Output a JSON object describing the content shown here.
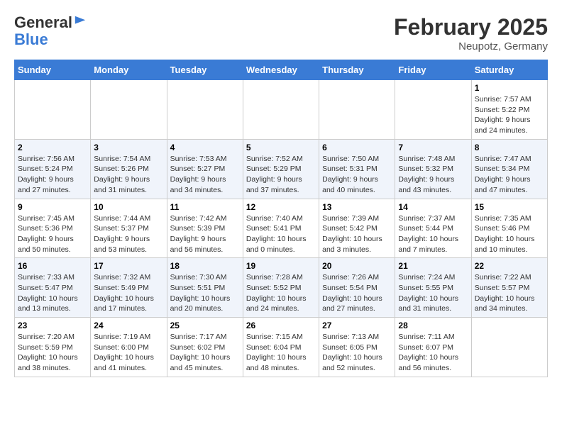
{
  "header": {
    "logo_general": "General",
    "logo_blue": "Blue",
    "month_title": "February 2025",
    "location": "Neupotz, Germany"
  },
  "days_of_week": [
    "Sunday",
    "Monday",
    "Tuesday",
    "Wednesday",
    "Thursday",
    "Friday",
    "Saturday"
  ],
  "weeks": [
    [
      {
        "day": "",
        "info": ""
      },
      {
        "day": "",
        "info": ""
      },
      {
        "day": "",
        "info": ""
      },
      {
        "day": "",
        "info": ""
      },
      {
        "day": "",
        "info": ""
      },
      {
        "day": "",
        "info": ""
      },
      {
        "day": "1",
        "info": "Sunrise: 7:57 AM\nSunset: 5:22 PM\nDaylight: 9 hours and 24 minutes."
      }
    ],
    [
      {
        "day": "2",
        "info": "Sunrise: 7:56 AM\nSunset: 5:24 PM\nDaylight: 9 hours and 27 minutes."
      },
      {
        "day": "3",
        "info": "Sunrise: 7:54 AM\nSunset: 5:26 PM\nDaylight: 9 hours and 31 minutes."
      },
      {
        "day": "4",
        "info": "Sunrise: 7:53 AM\nSunset: 5:27 PM\nDaylight: 9 hours and 34 minutes."
      },
      {
        "day": "5",
        "info": "Sunrise: 7:52 AM\nSunset: 5:29 PM\nDaylight: 9 hours and 37 minutes."
      },
      {
        "day": "6",
        "info": "Sunrise: 7:50 AM\nSunset: 5:31 PM\nDaylight: 9 hours and 40 minutes."
      },
      {
        "day": "7",
        "info": "Sunrise: 7:48 AM\nSunset: 5:32 PM\nDaylight: 9 hours and 43 minutes."
      },
      {
        "day": "8",
        "info": "Sunrise: 7:47 AM\nSunset: 5:34 PM\nDaylight: 9 hours and 47 minutes."
      }
    ],
    [
      {
        "day": "9",
        "info": "Sunrise: 7:45 AM\nSunset: 5:36 PM\nDaylight: 9 hours and 50 minutes."
      },
      {
        "day": "10",
        "info": "Sunrise: 7:44 AM\nSunset: 5:37 PM\nDaylight: 9 hours and 53 minutes."
      },
      {
        "day": "11",
        "info": "Sunrise: 7:42 AM\nSunset: 5:39 PM\nDaylight: 9 hours and 56 minutes."
      },
      {
        "day": "12",
        "info": "Sunrise: 7:40 AM\nSunset: 5:41 PM\nDaylight: 10 hours and 0 minutes."
      },
      {
        "day": "13",
        "info": "Sunrise: 7:39 AM\nSunset: 5:42 PM\nDaylight: 10 hours and 3 minutes."
      },
      {
        "day": "14",
        "info": "Sunrise: 7:37 AM\nSunset: 5:44 PM\nDaylight: 10 hours and 7 minutes."
      },
      {
        "day": "15",
        "info": "Sunrise: 7:35 AM\nSunset: 5:46 PM\nDaylight: 10 hours and 10 minutes."
      }
    ],
    [
      {
        "day": "16",
        "info": "Sunrise: 7:33 AM\nSunset: 5:47 PM\nDaylight: 10 hours and 13 minutes."
      },
      {
        "day": "17",
        "info": "Sunrise: 7:32 AM\nSunset: 5:49 PM\nDaylight: 10 hours and 17 minutes."
      },
      {
        "day": "18",
        "info": "Sunrise: 7:30 AM\nSunset: 5:51 PM\nDaylight: 10 hours and 20 minutes."
      },
      {
        "day": "19",
        "info": "Sunrise: 7:28 AM\nSunset: 5:52 PM\nDaylight: 10 hours and 24 minutes."
      },
      {
        "day": "20",
        "info": "Sunrise: 7:26 AM\nSunset: 5:54 PM\nDaylight: 10 hours and 27 minutes."
      },
      {
        "day": "21",
        "info": "Sunrise: 7:24 AM\nSunset: 5:55 PM\nDaylight: 10 hours and 31 minutes."
      },
      {
        "day": "22",
        "info": "Sunrise: 7:22 AM\nSunset: 5:57 PM\nDaylight: 10 hours and 34 minutes."
      }
    ],
    [
      {
        "day": "23",
        "info": "Sunrise: 7:20 AM\nSunset: 5:59 PM\nDaylight: 10 hours and 38 minutes."
      },
      {
        "day": "24",
        "info": "Sunrise: 7:19 AM\nSunset: 6:00 PM\nDaylight: 10 hours and 41 minutes."
      },
      {
        "day": "25",
        "info": "Sunrise: 7:17 AM\nSunset: 6:02 PM\nDaylight: 10 hours and 45 minutes."
      },
      {
        "day": "26",
        "info": "Sunrise: 7:15 AM\nSunset: 6:04 PM\nDaylight: 10 hours and 48 minutes."
      },
      {
        "day": "27",
        "info": "Sunrise: 7:13 AM\nSunset: 6:05 PM\nDaylight: 10 hours and 52 minutes."
      },
      {
        "day": "28",
        "info": "Sunrise: 7:11 AM\nSunset: 6:07 PM\nDaylight: 10 hours and 56 minutes."
      },
      {
        "day": "",
        "info": ""
      }
    ]
  ]
}
